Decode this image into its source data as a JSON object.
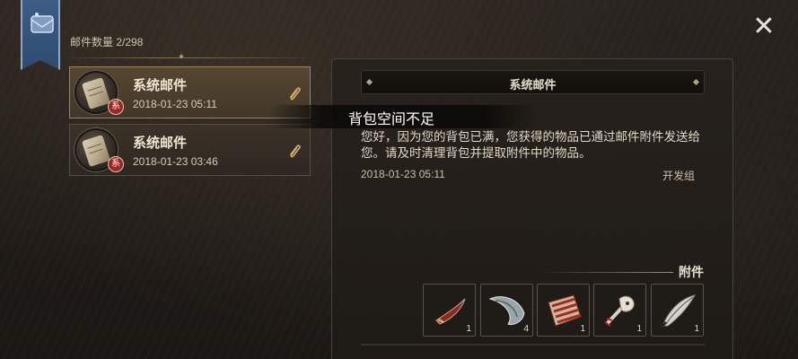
{
  "mail_count": {
    "label": "邮件数量",
    "value": "2/298"
  },
  "mail_list": [
    {
      "title": "系统邮件",
      "time": "2018-01-23 05:11",
      "badge": "系",
      "selected": true
    },
    {
      "title": "系统邮件",
      "time": "2018-01-23 03:46",
      "badge": "系",
      "selected": false
    }
  ],
  "tooltip": "背包空间不足",
  "detail": {
    "title": "系统邮件",
    "body": "您好，因为您的背包已满，您获得的物品已通过邮件附件发送给您。请及时清理背包并提取附件中的物品。",
    "time": "2018-01-23 05:11",
    "sender": "开发组",
    "attachments_label": "附件",
    "attachments": [
      {
        "icon": "curved-blade-icon",
        "qty": "1"
      },
      {
        "icon": "crescent-shield-icon",
        "qty": "4"
      },
      {
        "icon": "striped-cloth-icon",
        "qty": "1"
      },
      {
        "icon": "bone-skull-icon",
        "qty": "1"
      },
      {
        "icon": "feather-claw-icon",
        "qty": "1"
      }
    ]
  },
  "close_icon": "close-icon",
  "colors": {
    "selected_border": "#9c8560",
    "badge_red": "#a02626",
    "banner_blue": "#3d5c86"
  }
}
